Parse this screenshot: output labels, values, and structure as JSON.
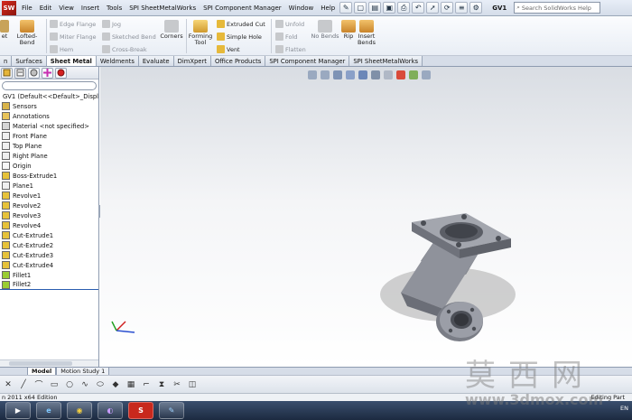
{
  "menubar": {
    "logo_text": "SW",
    "items": [
      "File",
      "Edit",
      "View",
      "Insert",
      "Tools",
      "SPI SheetMetalWorks",
      "SPI Component Manager",
      "Window",
      "Help"
    ],
    "document_name": "GV1",
    "search_placeholder": "Search SolidWorks Help"
  },
  "commands": {
    "lofted_bend": "Lofted-Bend",
    "sheet_cut": "et",
    "edge_flange": "Edge Flange",
    "miter_flange": "Miter Flange",
    "hem": "Hem",
    "jog": "Jog",
    "sketched_bend": "Sketched Bend",
    "cross_break": "Cross-Break",
    "corners": "Corners",
    "forming_tool": "Forming\nTool",
    "extruded_cut": "Extruded Cut",
    "simple_hole": "Simple Hole",
    "vent": "Vent",
    "unfold": "Unfold",
    "fold": "Fold",
    "flatten": "Flatten",
    "no_bends": "No Bends",
    "rip": "Rip",
    "insert_bends": "Insert\nBends",
    "rip_prefix": "nt"
  },
  "tabs": [
    {
      "label": "n",
      "active": false
    },
    {
      "label": "Surfaces",
      "active": false
    },
    {
      "label": "Sheet Metal",
      "active": true
    },
    {
      "label": "Weldments",
      "active": false
    },
    {
      "label": "Evaluate",
      "active": false
    },
    {
      "label": "DimXpert",
      "active": false
    },
    {
      "label": "Office Products",
      "active": false
    },
    {
      "label": "SPI Component Manager",
      "active": false
    },
    {
      "label": "SPI SheetMetalWorks",
      "active": false
    }
  ],
  "tree": {
    "root": "GV1  (Default<<Default>_Display",
    "items": [
      {
        "label": "Sensors",
        "icon": "sensor-icon",
        "color": "#d9b44a"
      },
      {
        "label": "Annotations",
        "icon": "annotation-icon",
        "color": "#e8c45a"
      },
      {
        "label": "Material <not specified>",
        "icon": "material-icon",
        "color": "#d6d6d6"
      },
      {
        "label": "Front Plane",
        "icon": "plane-icon",
        "color": "#f0f0f0"
      },
      {
        "label": "Top Plane",
        "icon": "plane-icon",
        "color": "#f0f0f0"
      },
      {
        "label": "Right Plane",
        "icon": "plane-icon",
        "color": "#f0f0f0"
      },
      {
        "label": "Origin",
        "icon": "origin-icon",
        "color": "#f7f7f7"
      },
      {
        "label": "Boss-Extrude1",
        "icon": "extrude-icon",
        "color": "#e6c23a"
      },
      {
        "label": "Plane1",
        "icon": "plane-icon",
        "color": "#f0f0f0"
      },
      {
        "label": "Revolve1",
        "icon": "revolve-icon",
        "color": "#e6c23a"
      },
      {
        "label": "Revolve2",
        "icon": "revolve-icon",
        "color": "#e6c23a"
      },
      {
        "label": "Revolve3",
        "icon": "revolve-icon",
        "color": "#e6c23a"
      },
      {
        "label": "Revolve4",
        "icon": "revolve-icon",
        "color": "#e6c23a"
      },
      {
        "label": "Cut-Extrude1",
        "icon": "cut-extrude-icon",
        "color": "#e6c23a"
      },
      {
        "label": "Cut-Extrude2",
        "icon": "cut-extrude-icon",
        "color": "#e6c23a"
      },
      {
        "label": "Cut-Extrude3",
        "icon": "cut-extrude-icon",
        "color": "#e6c23a"
      },
      {
        "label": "Cut-Extrude4",
        "icon": "cut-extrude-icon",
        "color": "#e6c23a"
      },
      {
        "label": "Fillet1",
        "icon": "fillet-icon",
        "color": "#9acd32"
      },
      {
        "label": "Fillet2",
        "icon": "fillet-icon",
        "color": "#9acd32"
      }
    ]
  },
  "model_tabs": [
    {
      "label": "Model",
      "active": true
    },
    {
      "label": "Motion Study 1",
      "active": false
    }
  ],
  "status": {
    "left": "n 2011 x64 Edition",
    "right": "Editing Part"
  },
  "tray": {
    "language": "EN"
  },
  "watermark": {
    "chinese": "莫西网",
    "url": "www.3dmox.com"
  },
  "colors": {
    "accent_red": "#c8281d",
    "selection_blue": "#2a5db0",
    "part_gray": "#8a8d96"
  }
}
